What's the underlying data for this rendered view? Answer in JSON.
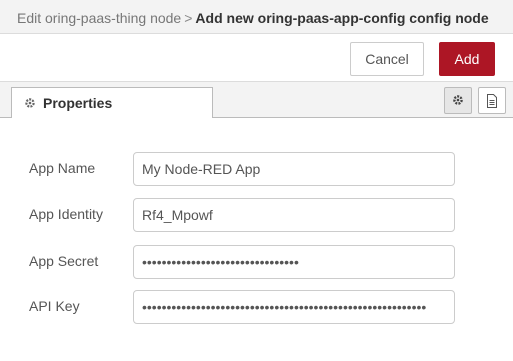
{
  "header": {
    "breadcrumb": "Edit oring-paas-thing node",
    "separator": ">",
    "title": "Add new oring-paas-app-config config node"
  },
  "toolbar": {
    "cancel_label": "Cancel",
    "add_label": "Add",
    "add_color": "#ad1625"
  },
  "tabs": {
    "properties_label": "Properties",
    "properties_icon": "gear-icon",
    "settings_icon": "gear-icon",
    "description_icon": "document-icon"
  },
  "form": {
    "app_name": {
      "label": "App Name",
      "value": "My Node-RED App"
    },
    "app_identity": {
      "label": "App Identity",
      "value": "Rf4_Mpowf"
    },
    "app_secret": {
      "label": "App Secret",
      "value": "••••••••••••••••••••••••••••••••"
    },
    "api_key": {
      "label": "API Key",
      "value": "••••••••••••••••••••••••••••••••••••••••••••••••••••••••••"
    }
  }
}
